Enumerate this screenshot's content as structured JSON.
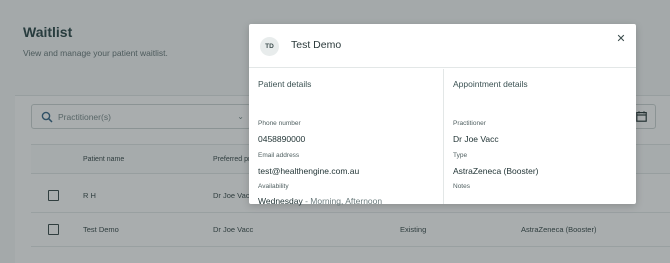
{
  "page": {
    "title": "Waitlist",
    "subtitle": "View and manage your patient waitlist.",
    "filter_placeholder": "Practitioner(s)"
  },
  "table": {
    "headers": [
      "Patient name",
      "Preferred pr"
    ],
    "rows": [
      {
        "patient": "R H",
        "practitioner": "Dr Joe Vacc",
        "status": "",
        "type": ""
      },
      {
        "patient": "Test Demo",
        "practitioner": "Dr Joe Vacc",
        "status": "Existing",
        "type": "AstraZeneca (Booster)"
      }
    ]
  },
  "modal": {
    "avatar_initials": "TD",
    "title": "Test Demo",
    "close_icon": "close-icon",
    "patient_details": {
      "heading": "Patient details",
      "phone_label": "Phone number",
      "phone_value": "0458890000",
      "email_label": "Email address",
      "email_value": "test@healthengine.com.au",
      "availability_label": "Availability",
      "availability_day": "Wednesday",
      "availability_times": " - Morning, Afternoon"
    },
    "appointment_details": {
      "heading": "Appointment details",
      "practitioner_label": "Practitioner",
      "practitioner_value": "Dr Joe Vacc",
      "type_label": "Type",
      "type_value": "AstraZeneca (Booster)",
      "notes_label": "Notes"
    }
  },
  "colors": {
    "overlay": "#1e282a",
    "text_primary": "#1f3233",
    "accent": "#3a6a8a"
  }
}
